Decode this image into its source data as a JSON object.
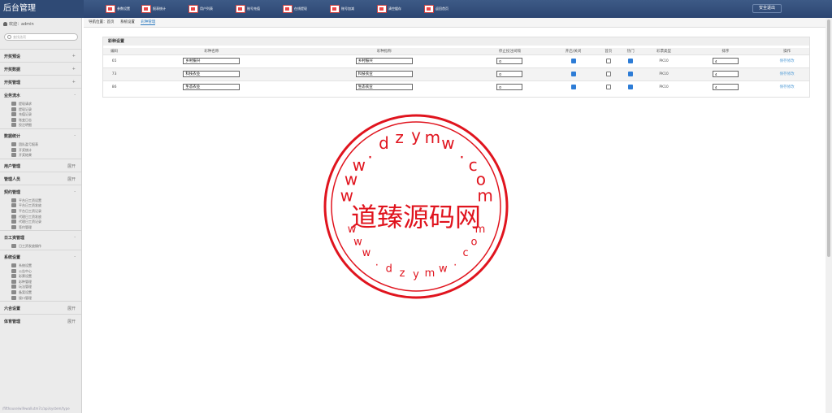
{
  "app": {
    "title": "后台管理",
    "logout": "安全退出"
  },
  "topnav": [
    "参数设置",
    "报表统计",
    "用户列表",
    "账号充值",
    "在线提现",
    "账号加减",
    "清空缓存",
    "返回首页"
  ],
  "sidebar": {
    "welcome": "欢迎：admin",
    "search_placeholder": "查找选项",
    "groups": [
      {
        "label": "开奖预设",
        "toggle": "+"
      },
      {
        "label": "开奖数据",
        "toggle": "+"
      },
      {
        "label": "开奖管理",
        "toggle": "+"
      },
      {
        "label": "业务流水",
        "toggle": "-",
        "items": [
          "提现请求",
          "提现记录",
          "充值记录",
          "账变日志",
          "投注明细"
        ]
      },
      {
        "label": "数据统计",
        "toggle": "-",
        "items": [
          "团队盈亏报表",
          "开奖统计",
          "开奖结果"
        ]
      },
      {
        "label": "用户管理",
        "toggle": "展开"
      },
      {
        "label": "管理人员",
        "toggle": "展开"
      },
      {
        "label": "契约管理",
        "toggle": "-",
        "items": [
          "平台日工资设置",
          "平台日工资发放",
          "平台日工资记录",
          "代理日工资发放",
          "代理日工资记录",
          "签约管理"
        ]
      },
      {
        "label": "日工资管理",
        "toggle": "-",
        "items": [
          "日工资发放操作"
        ]
      },
      {
        "label": "系统设置",
        "toggle": "-",
        "items": [
          "系统设置",
          "公告中心",
          "彩票设置",
          "彩种管理",
          "玩法管理",
          "备案设置",
          "接口管理"
        ]
      },
      {
        "label": "六合设置",
        "toggle": "展开"
      },
      {
        "label": "体育管理",
        "toggle": "展开"
      }
    ],
    "url": "/fifthouse/wifewallutm7c/api/system/type"
  },
  "breadcrumb": [
    "导航位置：首页",
    "系统设置",
    "彩种管理"
  ],
  "panel": {
    "title": "彩种设置",
    "headers": [
      "编码",
      "彩种名称",
      "彩种指称",
      "停止投注间隔",
      "开启/关闭",
      "首页",
      "热门",
      "彩票类型",
      "排序",
      "操作"
    ],
    "rows": [
      {
        "id": "65",
        "name": "乡村振兴",
        "alias": "乡村振兴",
        "interval": "0",
        "open": true,
        "home": false,
        "hot": true,
        "type": "PK10",
        "sort": "4",
        "action": "保存修改"
      },
      {
        "id": "73",
        "name": "科技农业",
        "alias": "科技农业",
        "interval": "0",
        "open": true,
        "home": false,
        "hot": true,
        "type": "PK10",
        "sort": "4",
        "action": "保存修改"
      },
      {
        "id": "86",
        "name": "生态农业",
        "alias": "生态农业",
        "interval": "0",
        "open": true,
        "home": false,
        "hot": true,
        "type": "PK10",
        "sort": "4",
        "action": "保存修改"
      }
    ]
  },
  "watermark": {
    "text": "道臻源码网",
    "ring_top": "www.dzymw.com",
    "ring_bottom": "www.dzymw.com",
    "color": "#e0141e"
  }
}
